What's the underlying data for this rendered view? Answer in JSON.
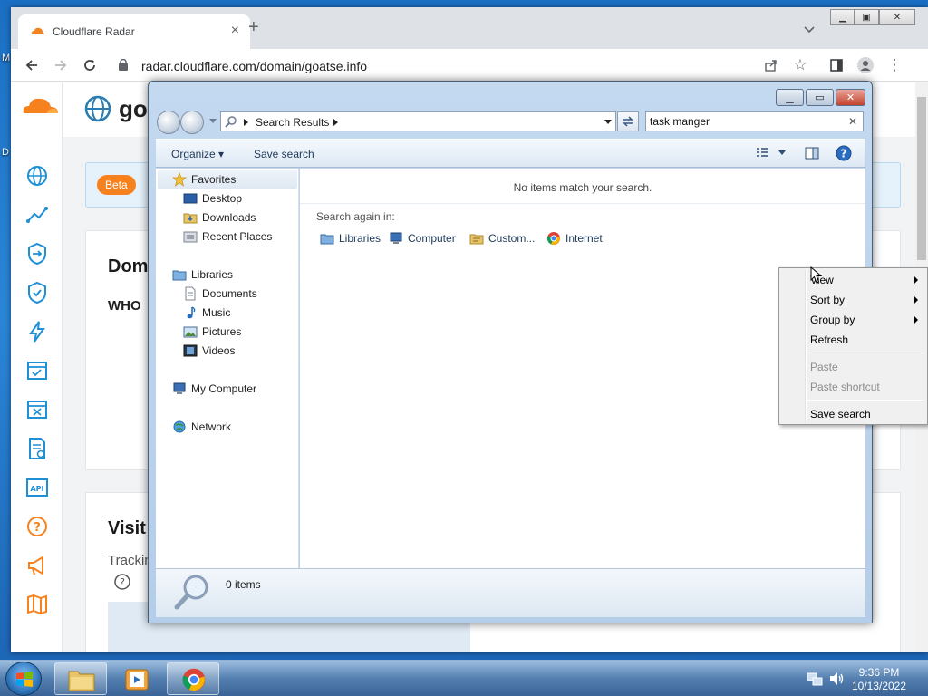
{
  "desktop": {
    "edge_label_top": "M",
    "edge_label_mid": "D"
  },
  "browser": {
    "tab_title": "Cloudflare Radar",
    "url": "radar.cloudflare.com/domain/goatse.info",
    "accent_color": "#f6821f"
  },
  "page": {
    "site_title": "goa",
    "beta_badge": "Beta",
    "card1_heading": "Dom",
    "card1_subheading": "WHO",
    "card2_heading": "Visit",
    "card2_text": "Trackin"
  },
  "explorer": {
    "breadcrumb": "Search Results",
    "search_value": "task manger",
    "toolbar": {
      "organize": "Organize",
      "save_search": "Save search"
    },
    "nav": {
      "favorites": "Favorites",
      "desktop": "Desktop",
      "downloads": "Downloads",
      "recent_places": "Recent Places",
      "libraries": "Libraries",
      "documents": "Documents",
      "music": "Music",
      "pictures": "Pictures",
      "videos": "Videos",
      "my_computer": "My Computer",
      "network": "Network"
    },
    "content": {
      "empty_message": "No items match your search.",
      "search_again_label": "Search again in:",
      "locations": [
        "Libraries",
        "Computer",
        "Custom...",
        "Internet"
      ]
    },
    "details_count": "0 items"
  },
  "context_menu": {
    "items": [
      {
        "label": "View",
        "submenu": true,
        "enabled": true
      },
      {
        "label": "Sort by",
        "submenu": true,
        "enabled": true
      },
      {
        "label": "Group by",
        "submenu": true,
        "enabled": true
      },
      {
        "label": "Refresh",
        "submenu": false,
        "enabled": true
      },
      {
        "label": "Paste",
        "submenu": false,
        "enabled": false
      },
      {
        "label": "Paste shortcut",
        "submenu": false,
        "enabled": false
      },
      {
        "label": "Save search",
        "submenu": false,
        "enabled": true
      }
    ]
  },
  "taskbar": {
    "time": "9:36 PM",
    "date": "10/13/2022"
  }
}
